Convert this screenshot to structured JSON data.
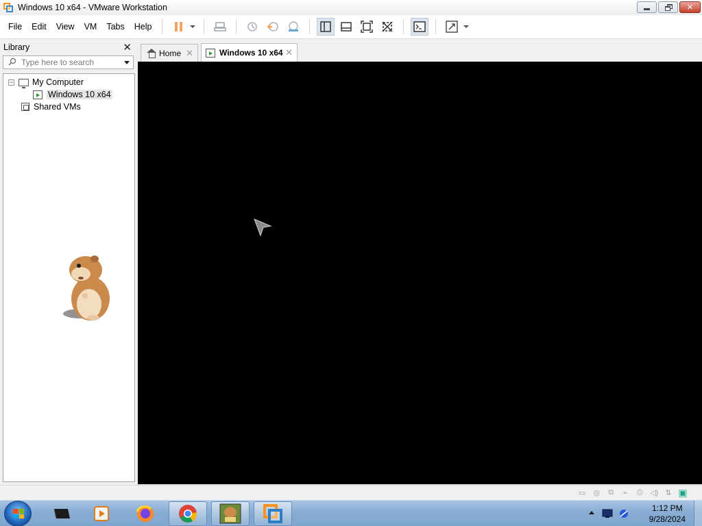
{
  "window": {
    "title": "Windows 10 x64 - VMware Workstation",
    "minimize_icon": "minimize-icon",
    "restore_icon": "restore-icon",
    "close_glyph": "✕"
  },
  "menu": {
    "items": [
      "File",
      "Edit",
      "View",
      "VM",
      "Tabs",
      "Help"
    ]
  },
  "library": {
    "title": "Library",
    "close_glyph": "✕",
    "search_placeholder": "Type here to search",
    "tree": {
      "my_computer": "My Computer",
      "expander": "⊟",
      "vm_item": "Windows 10 x64",
      "shared": "Shared VMs"
    }
  },
  "tabs": [
    {
      "label": "Home",
      "icon": "home-icon",
      "close": "✕"
    },
    {
      "label": "Windows 10 x64",
      "icon": "vm-icon",
      "close": "✕"
    }
  ],
  "clock": {
    "time": "1:12 PM",
    "date": "9/28/2024"
  },
  "colors": {
    "vm_display": "#000000",
    "taskbar": "#8aaed4",
    "pause_accent": "#f4a460"
  }
}
